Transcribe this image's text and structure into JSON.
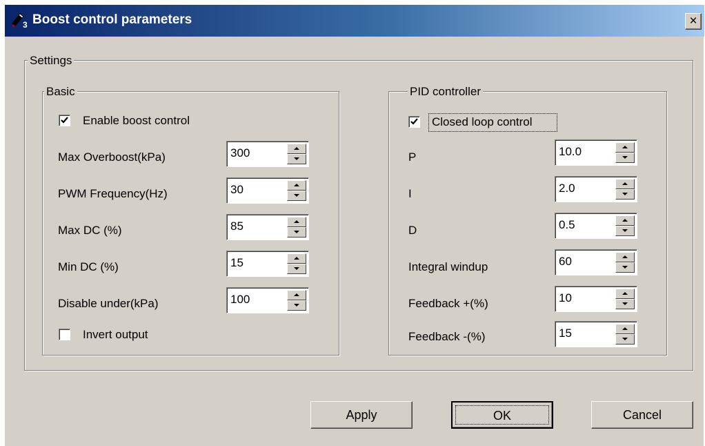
{
  "window": {
    "title": "Boost control parameters",
    "close_label": "×"
  },
  "settings": {
    "legend": "Settings",
    "basic": {
      "legend": "Basic",
      "enable_boost": {
        "label": "Enable boost control",
        "checked": true
      },
      "fields": [
        {
          "label": "Max Overboost(kPa)",
          "value": "300"
        },
        {
          "label": "PWM Frequency(Hz)",
          "value": "30"
        },
        {
          "label": "Max DC (%)",
          "value": "85"
        },
        {
          "label": "Min DC (%)",
          "value": "15"
        },
        {
          "label": "Disable under(kPa)",
          "value": "100"
        }
      ],
      "invert_output": {
        "label": "Invert output",
        "checked": false
      }
    },
    "pid": {
      "legend": "PID controller",
      "closed_loop": {
        "label": "Closed loop control",
        "checked": true
      },
      "fields": [
        {
          "label": "P",
          "value": "10.0"
        },
        {
          "label": "I",
          "value": "2.0"
        },
        {
          "label": "D",
          "value": "0.5"
        },
        {
          "label": "Integral windup",
          "value": "60"
        },
        {
          "label": "Feedback +(%)",
          "value": "10"
        },
        {
          "label": "Feedback -(%)",
          "value": "15"
        }
      ]
    }
  },
  "buttons": {
    "apply": "Apply",
    "ok": "OK",
    "cancel": "Cancel"
  },
  "colors": {
    "title_bar_start": "#0a246a",
    "title_bar_end": "#a6caf0",
    "face": "#d4d0c8"
  }
}
